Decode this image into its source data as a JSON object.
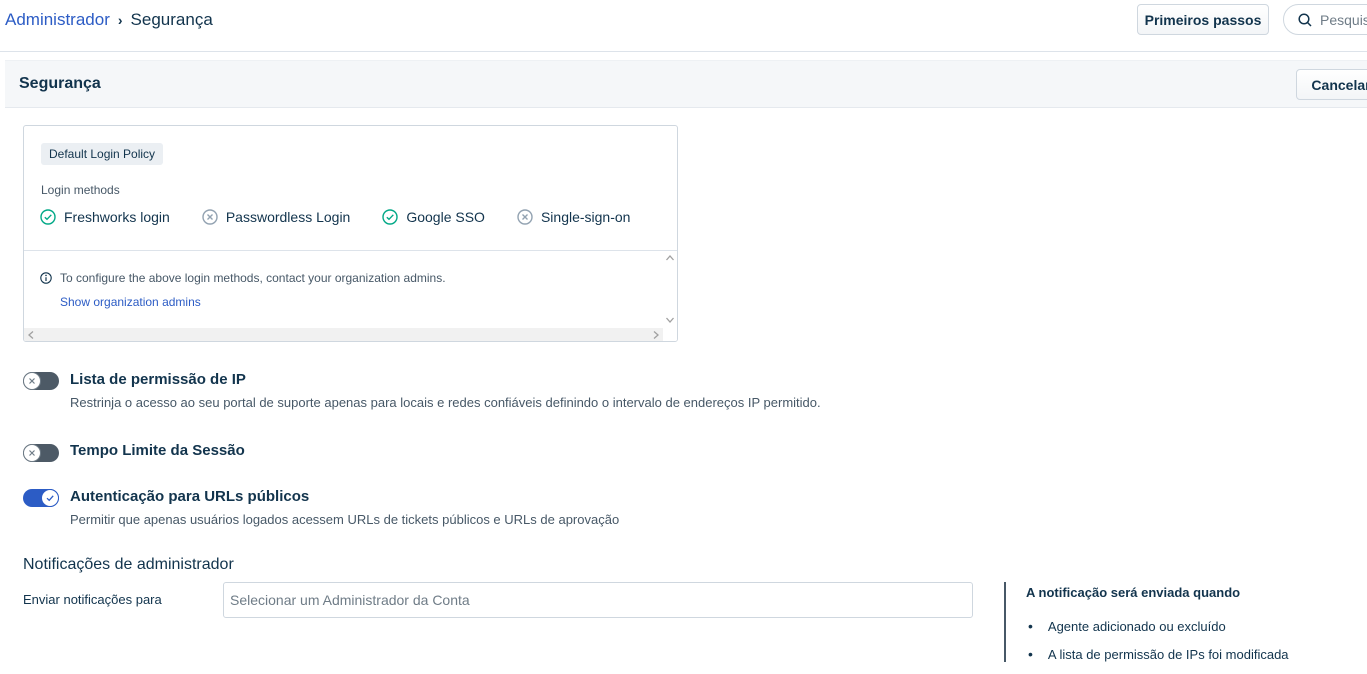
{
  "breadcrumb": {
    "parent": "Administrador",
    "separator": "›",
    "current": "Segurança"
  },
  "top_actions": {
    "getting_started": "Primeiros passos",
    "search_placeholder": "Pesquis"
  },
  "header": {
    "title": "Segurança",
    "cancel": "Cancelar"
  },
  "policy": {
    "tag": "Default Login Policy",
    "methods_label": "Login methods",
    "methods": [
      {
        "label": "Freshworks login",
        "enabled": true
      },
      {
        "label": "Passwordless Login",
        "enabled": false
      },
      {
        "label": "Google SSO",
        "enabled": true
      },
      {
        "label": "Single-sign-on",
        "enabled": false
      }
    ],
    "info": "To configure the above login methods, contact your organization admins.",
    "show_admins": "Show organization admins"
  },
  "settings": [
    {
      "title": "Lista de permissão de IP",
      "desc": "Restrinja o acesso ao seu portal de suporte apenas para locais e redes confiáveis definindo o intervalo de endereços IP permitido.",
      "enabled": false
    },
    {
      "title": "Tempo Limite da Sessão",
      "desc": "",
      "enabled": false
    },
    {
      "title": "Autenticação para URLs públicos",
      "desc": "Permitir que apenas usuários logados acessem URLs de tickets públicos e URLs de aprovação",
      "enabled": true
    }
  ],
  "notifications": {
    "section_title": "Notificações de administrador",
    "field_label": "Enviar notificações para",
    "input_placeholder": "Selecionar um Administrador da Conta",
    "side_title": "A notificação será enviada quando",
    "side_items": [
      "Agente adicionado ou excluído",
      "A lista de permissão de IPs foi modificada"
    ]
  },
  "colors": {
    "accent": "#2c5cc5",
    "success": "#00a886",
    "toggle_off": "#4d5a66",
    "text": "#12344d"
  }
}
